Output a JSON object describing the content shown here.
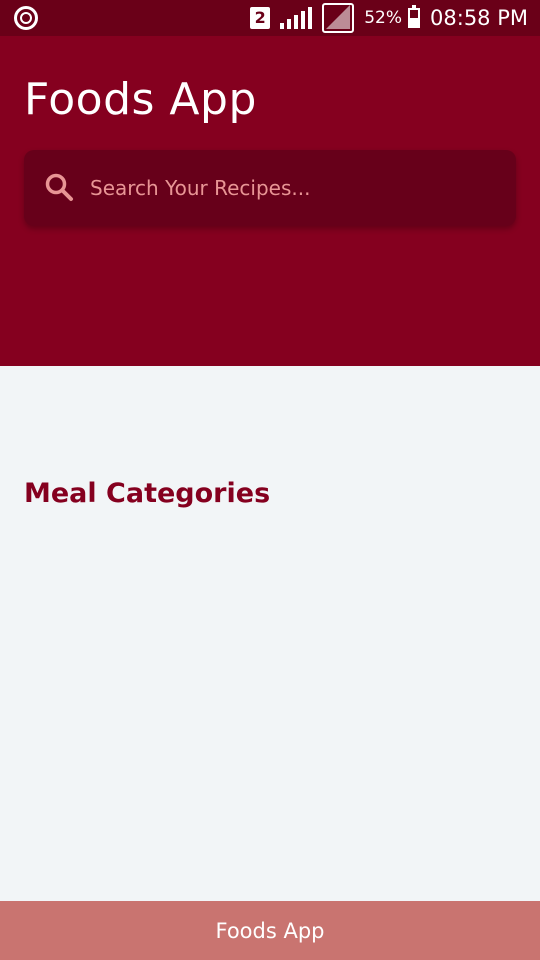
{
  "status_bar": {
    "sim_slot": "2",
    "battery_percent": "52%",
    "battery_level": 0.52,
    "time": "08:58 PM",
    "icons": [
      "power-icon",
      "sim-icon",
      "signal-icon",
      "signal-box-icon",
      "battery-icon"
    ]
  },
  "header": {
    "title": "Foods App",
    "background_color": "#85001f"
  },
  "search": {
    "placeholder": "Search Your Recipes...",
    "value": "",
    "icon": "search-icon"
  },
  "main": {
    "section_title": "Meal Categories"
  },
  "bottom_bar": {
    "label": "Foods App",
    "background_color": "#c97470"
  }
}
